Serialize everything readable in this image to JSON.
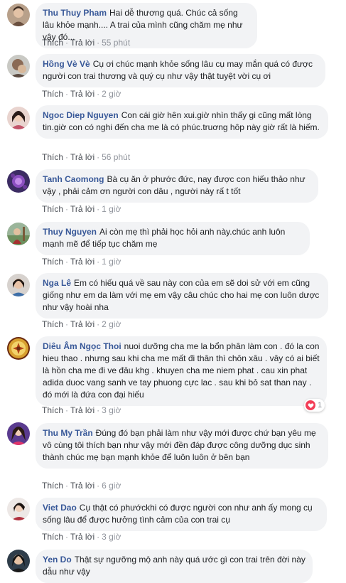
{
  "actions": {
    "like": "Thích",
    "reply": "Trả lời",
    "sep": "·"
  },
  "comments": [
    {
      "author": "Thu Thuy Pham",
      "text": "Hai dễ thương quá. Chúc cả sống lâu khỏe mạnh.... A trai của mình cũng chăm mẹ như vậy đó...",
      "time": "55 phút"
    },
    {
      "author": "Hồng Vè Vè",
      "text": "Cụ ơi chúc mạnh khỏe sống lâu cụ may mắn quá có được người con trai thương và quý cụ như vậy thật tuyệt vời cụ ơi",
      "time": "2 giờ"
    },
    {
      "author": "Ngoc Diep Nguyen",
      "text": "Con cái giờ hên xui.giờ nhìn thấy gi cũng mất lòng tin.giờ con có nghi đến cha me là có phúc.truơng hôp này giờ rất là hiếm.",
      "time": "56 phút"
    },
    {
      "author": "Tanh Caomong",
      "text": "Bà cụ ăn ở phước đức, nay được con hiếu thảo như vậy , phải cảm ơn người con dâu , người này rấ t tốt",
      "time": "1 giờ"
    },
    {
      "author": "Thuy Nguyen",
      "text": "Ai còn mẹ thì phải học hỏi anh này.chúc anh luôn mạnh mẽ để tiếp tục chăm mẹ",
      "time": "1 giờ"
    },
    {
      "author": "Nga Lê",
      "text": "Em có hiếu quá về sau này con của em sẽ doi sử với em cũng giống như em da làm với mẹ em vậy câu chúc cho hai mẹ con luôn dược như vậy hoài nha",
      "time": "2 giờ"
    },
    {
      "author": "Diêu Âm Ngọc Thoi",
      "text": "nuoi dưỡng cha me la bổn phân làm con . đó la con hieu thao . nhưng sau khi cha me mất đi thân thì chôn xâu . vây có ai biết là hồn cha me đi ve đâu khg . khuyen cha me niem phat . cau xin phat adida duoc vang sanh ve tay phuong cực lac . sau khi bỏ sat than nay . đó mới là đứa con đại hiếu",
      "time": "3 giờ",
      "reaction_count": "1"
    },
    {
      "author": "Thu My Trần",
      "text": "Đúng đó bạn phải làm như vậy mới được chứ bạn yêu mẹ vô cùng tôi thích bạn như vậy mới đền đáp được công dưỡng dục sinh thành chúc mẹ bạn mạnh khỏe để luôn luôn ở bên bạn",
      "time": "6 giờ"
    },
    {
      "author": "Viet Dao",
      "text": "Cụ thật có phướckhi có được người con như anh ấy mong cụ sống lâu để được hưởng tình cảm của con trai cụ",
      "time": "3 giờ"
    },
    {
      "author": "Yen Do",
      "text": "Thật sự ngưỡng mộ anh này quá ước gì con trai trên đời này dẫu như vậy",
      "time": ""
    }
  ],
  "colors": {
    "author": "#385898",
    "bubble": "#f2f3f5",
    "heart": "#f33e58"
  }
}
